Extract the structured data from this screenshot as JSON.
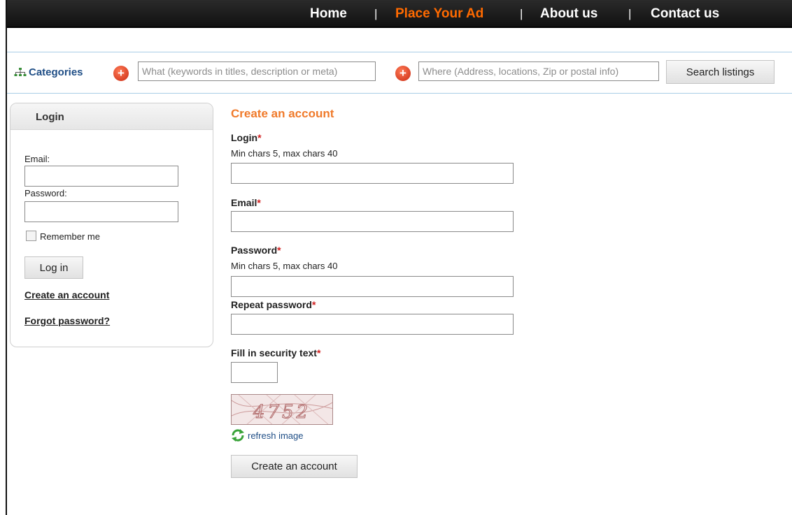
{
  "nav": {
    "items": [
      {
        "label": "Home"
      },
      {
        "label": "Place Your Ad"
      },
      {
        "label": "About us"
      },
      {
        "label": "Contact us"
      }
    ],
    "separator": "|"
  },
  "search": {
    "categories_label": "Categories",
    "what_placeholder": "What (keywords in titles, description or meta)",
    "where_placeholder": "Where (Address, locations, Zip or postal info)",
    "button_label": "Search listings"
  },
  "login_panel": {
    "title": "Login",
    "email_label": "Email:",
    "password_label": "Password:",
    "remember_label": "Remember me",
    "login_button": "Log in",
    "create_link": "Create an account",
    "forgot_link": "Forgot password?"
  },
  "register": {
    "title": "Create an account",
    "login_label": "Login",
    "login_hint": "Min chars 5, max chars 40",
    "email_label": "Email",
    "password_label": "Password",
    "password_hint": "Min chars 5, max chars 40",
    "repeat_label": "Repeat password",
    "security_label": "Fill in security text",
    "required_mark": "*",
    "captcha_text": "4752",
    "refresh_label": "refresh image",
    "submit_label": "Create an account"
  },
  "colors": {
    "accent": "#f07a2a",
    "nav_active": "#ff6a00",
    "link_blue": "#1f4e86",
    "required_red": "#d12020"
  }
}
